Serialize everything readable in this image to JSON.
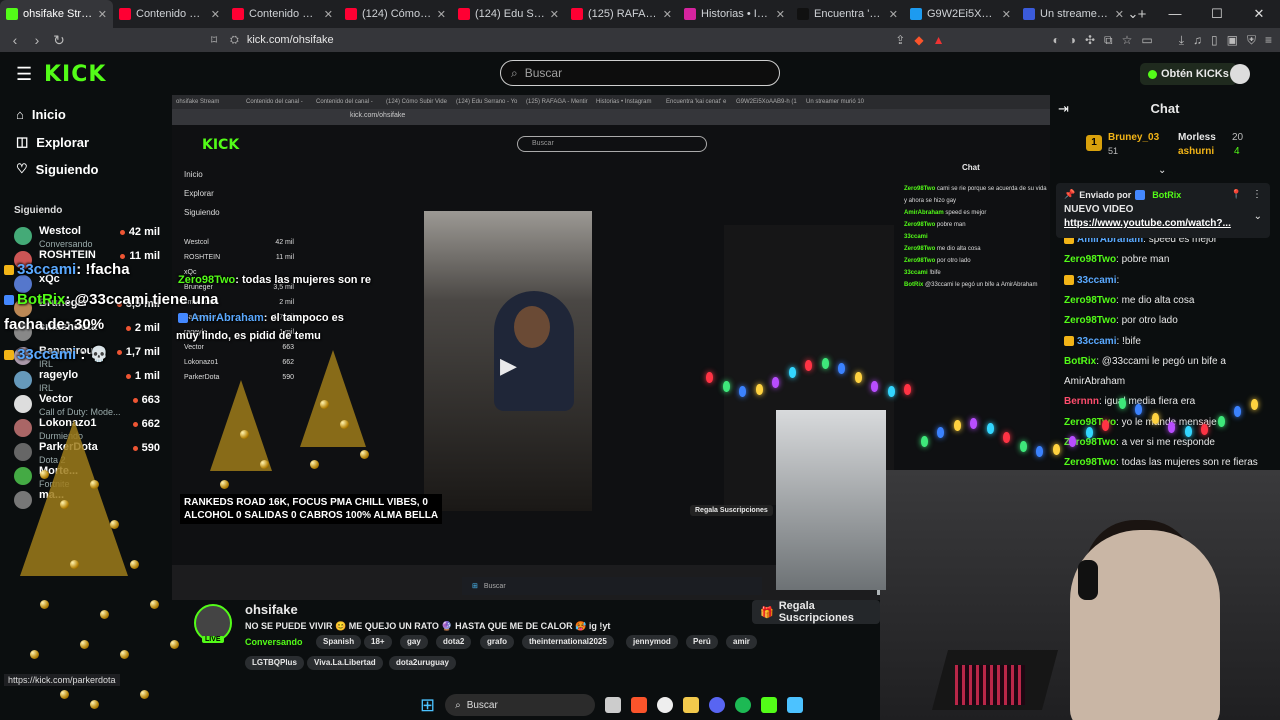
{
  "browser": {
    "tabs": [
      {
        "label": "ohsifake Stream",
        "color": "#53fc18",
        "active": true
      },
      {
        "label": "Contenido del canal -",
        "color": "#ff0033"
      },
      {
        "label": "Contenido del canal -",
        "color": "#ff0033"
      },
      {
        "label": "(124) Cómo Subir Vide",
        "color": "#ff0033"
      },
      {
        "label": "(124) Edu Serrano - Yo",
        "color": "#ff0033"
      },
      {
        "label": "(125) RAFAGA - Mentir",
        "color": "#ff0033"
      },
      {
        "label": "Historias • Instagram",
        "color": "#d6249f"
      },
      {
        "label": "Encuentra 'kai cenat' e",
        "color": "#111111"
      },
      {
        "label": "G9W2Ei5XoAAB9-h (1",
        "color": "#1d9bf0"
      },
      {
        "label": "Un streamer murió 10",
        "color": "#3b5bdb"
      }
    ],
    "url": "kick.com/ohsifake"
  },
  "header": {
    "logo": "KICK",
    "search_placeholder": "Buscar",
    "get_kicks": "Obtén KICKs"
  },
  "sidebar": {
    "nav": [
      {
        "label": "Inicio",
        "icon": "home-icon"
      },
      {
        "label": "Explorar",
        "icon": "compass-icon"
      },
      {
        "label": "Siguiendo",
        "icon": "heart-icon"
      }
    ],
    "following_title": "Siguiendo",
    "channels": [
      {
        "name": "Westcol",
        "category": "Conversando",
        "viewers": "42 mil",
        "color": "#4a7"
      },
      {
        "name": "ROSHTEIN",
        "category": "",
        "viewers": "11 mil",
        "color": "#c55"
      },
      {
        "name": "xQc",
        "category": "",
        "viewers": "",
        "color": "#57c"
      },
      {
        "name": "Bruneger",
        "category": "",
        "viewers": "3,5 mil",
        "color": "#b85"
      },
      {
        "name": "smashdota",
        "category": "",
        "viewers": "2 mil",
        "color": "#888"
      },
      {
        "name": "Bananirou",
        "category": "IRL",
        "viewers": "1,7 mil",
        "color": "#a9a"
      },
      {
        "name": "rageylo",
        "category": "IRL",
        "viewers": "1 mil",
        "color": "#69b"
      },
      {
        "name": "Vector",
        "category": "Call of Duty: Mode...",
        "viewers": "663",
        "color": "#ddd"
      },
      {
        "name": "Lokonazo1",
        "category": "Durmiendo",
        "viewers": "662",
        "color": "#a66"
      },
      {
        "name": "ParkerDota",
        "category": "Dota 2",
        "viewers": "590",
        "color": "#666"
      },
      {
        "name": "Morte...",
        "category": "Fortnite",
        "viewers": "",
        "color": "#4a4"
      },
      {
        "name": "ma...",
        "category": "",
        "viewers": "",
        "color": "#777"
      }
    ]
  },
  "overlay": {
    "chat1_user": "33ccami",
    "chat1_text": ": !facha",
    "chat2_user": "BotRix",
    "chat2_text": ": @33ccami tiene una",
    "chat2_text_b": "facha de: 30%",
    "chat3_user": "33ccami",
    "chat4_user": "Zero98Two",
    "chat4_text": ": todas las mujeres son re",
    "chat5_user": "AmirAbraham",
    "chat5_text": ": el tampoco es",
    "chat5_text_b": "muy lindo, es pidid de temu",
    "ranked_line1": "RANKEDS ROAD 16K, FOCUS PMA CHILL VIBES, 0",
    "ranked_line2": "ALCOHOL 0 SALIDAS 0 CABROS 100% ALMA BELLA"
  },
  "inner_screen": {
    "chat_title": "Chat",
    "search": "Buscar",
    "url": "kick.com/ohsifake",
    "nav": [
      "Inicio",
      "Explorar",
      "Siguiendo"
    ],
    "chat_lines": [
      {
        "user": "Zero98Two",
        "text": "cami se rie porque se acuerda de su vida"
      },
      {
        "user": "",
        "text": "y ahora se hizo gay"
      },
      {
        "user": "AmirAbraham",
        "text": "speed es mejor"
      },
      {
        "user": "Zero98Two",
        "text": "pobre man"
      },
      {
        "user": "33ccami",
        "text": ""
      },
      {
        "user": "Zero98Two",
        "text": "me dio alta cosa"
      },
      {
        "user": "Zero98Two",
        "text": "por otro lado"
      },
      {
        "user": "33ccami",
        "text": "!bife"
      },
      {
        "user": "BotRix",
        "text": "@33ccami le pegó un bife a AmirAbraham"
      }
    ],
    "taskbar_search": "Buscar",
    "regala": "Regala Suscripciones"
  },
  "chat": {
    "title": "Chat",
    "leaderboard": {
      "first": {
        "rank": "1",
        "name": "Bruney_03",
        "value": "51"
      },
      "second": {
        "name": "Morless",
        "value": "20"
      },
      "third": {
        "name": "ashurni",
        "value": "4"
      }
    },
    "pinned": {
      "sent_by": "Enviado por",
      "user": "BotRix",
      "title": "NUEVO VIDEO",
      "link": "https://www.youtube.com/watch?..."
    },
    "messages": [
      {
        "user": "AmirAbraham",
        "text": ": speed es mejor",
        "cls": "blue"
      },
      {
        "user": "Zero98Two",
        "text": ": pobre man",
        "cls": ""
      },
      {
        "user": "33ccami",
        "text": ":",
        "cls": "blue"
      },
      {
        "user": "Zero98Two",
        "text": ": me dio alta cosa",
        "cls": ""
      },
      {
        "user": "Zero98Two",
        "text": ": por otro lado",
        "cls": ""
      },
      {
        "user": "33ccami",
        "text": ": !bife",
        "cls": "blue"
      },
      {
        "user": "BotRix",
        "text": ": @33ccami le pegó un bife a",
        "cls": ""
      },
      {
        "user": "",
        "text": "AmirAbraham",
        "cls": ""
      },
      {
        "user": "Bernnn",
        "text": ": igual media fiera era",
        "cls": "red"
      },
      {
        "user": "Zero98Two",
        "text": ": yo le mande mensaje",
        "cls": ""
      },
      {
        "user": "Zero98Two",
        "text": ": a ver si me responde",
        "cls": ""
      },
      {
        "user": "Zero98Two",
        "text": ": todas las mujeres son re fieras",
        "cls": ""
      }
    ]
  },
  "stream_info": {
    "channel": "ohsifake",
    "live": "LIVE",
    "title": "NO SE PUEDE VIVIR 😊 ME QUEJO UN RATO 🔮 HASTA QUE ME DE CALOR 🥵 ig !yt",
    "category": "Conversando",
    "tags_row1": [
      "Spanish",
      "18+",
      "gay",
      "dota2",
      "grafo",
      "theinternational2025",
      "jennymod",
      "Perú",
      "amir"
    ],
    "tags_row2": [
      "LGTBQPlus",
      "Viva.La.Libertad",
      "dota2uruguay"
    ],
    "gift_subs": "Regala Suscripciones"
  },
  "taskbar": {
    "search": "Buscar"
  },
  "status_url": "https://kick.com/parkerdota"
}
